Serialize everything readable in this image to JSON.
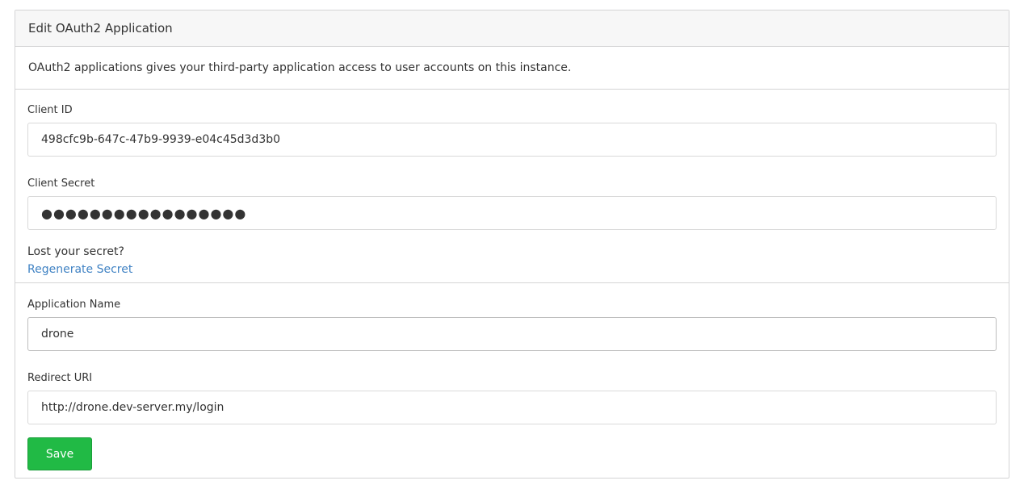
{
  "panel": {
    "title": "Edit OAuth2 Application",
    "intro": "OAuth2 applications gives your third-party application access to user accounts on this instance."
  },
  "client": {
    "id_label": "Client ID",
    "id_value": "498cfc9b-647c-47b9-9939-e04c45d3d3b0",
    "secret_label": "Client Secret",
    "secret_value": "●●●●●●●●●●●●●●●●●",
    "lost_text": "Lost your secret?",
    "regenerate_label": "Regenerate Secret"
  },
  "app": {
    "name_label": "Application Name",
    "name_value": "drone",
    "redirect_label": "Redirect URI",
    "redirect_value": "http://drone.dev-server.my/login",
    "save_label": "Save"
  },
  "colors": {
    "save_button": "#21ba45",
    "link": "#4183c4",
    "header_bg": "#f7f7f7"
  }
}
